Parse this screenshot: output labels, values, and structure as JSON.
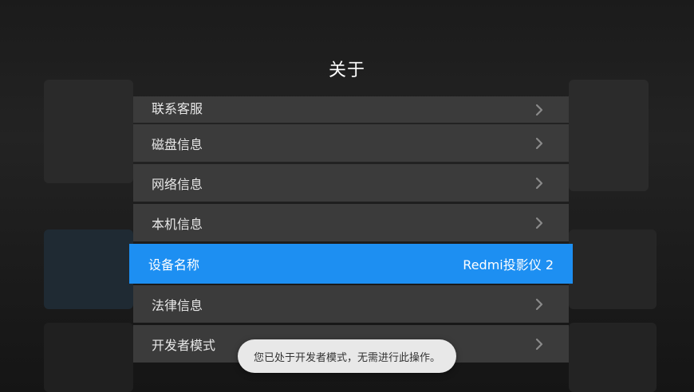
{
  "dialog": {
    "title": "关于"
  },
  "menu": [
    {
      "label": "联系客服",
      "icon": "chevron-right-icon"
    },
    {
      "label": "磁盘信息",
      "icon": "chevron-right-icon"
    },
    {
      "label": "网络信息",
      "icon": "chevron-right-icon"
    },
    {
      "label": "本机信息",
      "icon": "chevron-right-icon"
    },
    {
      "label": "设备名称",
      "value": "Redmi投影仪 2",
      "focused": true
    },
    {
      "label": "法律信息",
      "icon": "chevron-right-icon"
    },
    {
      "label": "开发者模式",
      "icon": "chevron-right-icon"
    }
  ],
  "toast": {
    "message": "您已处于开发者模式，无需进行此操作。"
  },
  "colors": {
    "focus": "#1d8ff2",
    "item_bg": "#3b3b3b",
    "toast_bg": "#e8e8e8"
  }
}
